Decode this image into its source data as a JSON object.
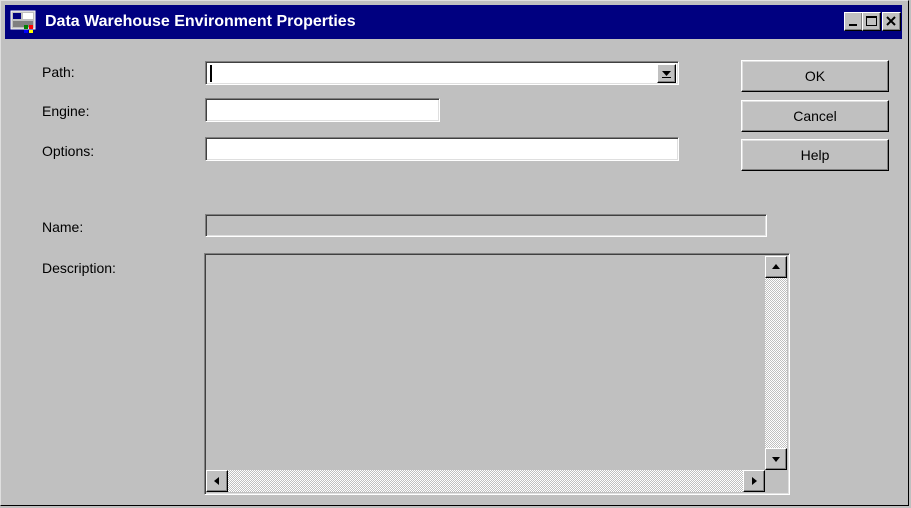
{
  "window": {
    "title": "Data Warehouse Environment Properties",
    "controls": [
      "minimize-icon",
      "maximize-icon",
      "close-icon"
    ]
  },
  "form": {
    "path_label": "Path:",
    "path_value": "",
    "engine_label": "Engine:",
    "engine_value": "",
    "options_label": "Options:",
    "options_value": "",
    "name_label": "Name:",
    "name_value": "",
    "description_label": "Description:",
    "description_value": ""
  },
  "buttons": {
    "ok": "OK",
    "cancel": "Cancel",
    "help": "Help"
  },
  "colors": {
    "titlebar": "#000080",
    "dialog_bg": "#c0c0c0",
    "field_bg": "#ffffff"
  }
}
